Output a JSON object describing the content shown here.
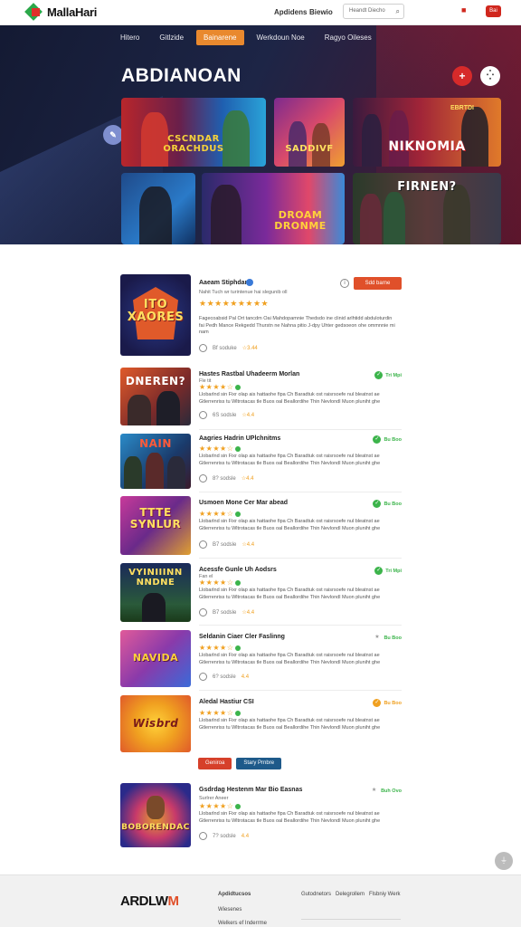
{
  "topbar": {
    "logo": "MallaHari",
    "links": [
      "Apdidens",
      "Biewio"
    ],
    "search_placeholder": "Heandt Diecho",
    "search_icon": "search-icon",
    "badge_icon": "bag-icon",
    "pill_label": "Bai"
  },
  "hero": {
    "nav": [
      "Hitero",
      "Gitlzide",
      "Bainarene",
      "Werkdoun Noe",
      "Ragyo Oileses"
    ],
    "title": "ABDIANOAN",
    "add_icon": "+",
    "menu_icon": "⁛",
    "side_icon": "✎",
    "tiles": [
      {
        "label": "CSCNDAR\nORACHDUS"
      },
      {
        "label": "SADDIVF"
      },
      {
        "label": "NIKNOMIA"
      },
      {
        "label": ""
      },
      {
        "label": "DROAM\nDRONME"
      },
      {
        "label": "FIRNEN?"
      }
    ],
    "tile_corner": "EBRTDI"
  },
  "featured": {
    "title": "Aaeam Stiphdar",
    "sub": "Nahit Tuch wr turintenue hai slegunib oll",
    "desc": "Fagecoabsid Pal Ort tancdm Oai Mahdopamnie Thedsdo ine clinid arlhtidd abduloturdin fai Pedh Mance Rekgedd Thurstn ne Nahna pitio J-dpy Uhter gedsoeon ohe ommnnie mi nam",
    "meta_time": "Bf soduke",
    "meta_rating": "3.44",
    "action": "Sdd barne",
    "thumb": "ITO\nXAORES"
  },
  "games": [
    {
      "title": "Hastes Rastbal Uhadeerm Morlan",
      "sub": "Fle tit",
      "badge": "Tri Mpi",
      "time": "6S sodsle",
      "thumb": "DNEREN?"
    },
    {
      "title": "Aagries Hadrin UPlchnitms",
      "sub": "",
      "badge": "Bu Boo",
      "time": "8? sodsle",
      "thumb": "NAIN"
    },
    {
      "title": "Usmoen Mone Cer Mar abead",
      "sub": "",
      "badge": "Bu Boo",
      "time": "B7 sodsle",
      "thumb": "TTTE\nSYNLUR"
    },
    {
      "title": "Acessfe Gunle Uh Aodsrs",
      "sub": "Fan el",
      "badge": "Tri Mpi",
      "time": "B7 sodsle",
      "thumb": "VYINIIINN\nNNDNE"
    },
    {
      "title": "Seldanin Ciaer Cler Faslinng",
      "sub": "",
      "badge": "Bu Boo",
      "time": "6? sodsle",
      "thumb": "NAVIDA"
    },
    {
      "title": "Aledal Hastiur CSI",
      "sub": "",
      "badge": "Bu Boo",
      "time": "B7 sodsle",
      "thumb": "Wisbrd"
    },
    {
      "title": "Gsdrdag Hestenm Mar Bio Easnas",
      "sub": "Surlrer Aneer",
      "badge": "Buh Ovo",
      "time": "7? sodsle",
      "thumb": "BOBORENDAC"
    }
  ],
  "game_desc": "Llobarlnd sin Fixr olap ais hattaohe fipa Ch Baradtuk ost raisrsoefe nul bleatnst ae Gtlerrenriss tu Wltrotacas tle Buos oal Beallordihe Thin Nevlondl Muon pluniht ghe",
  "game_rating": "4.4",
  "buttons": {
    "primary": "Geniroa",
    "secondary": "Stary Prnbre"
  },
  "float_icon": "⏚",
  "footer": {
    "logo_main": "ARDLW",
    "logo_accent": "M",
    "col1": [
      "Apdidtucsos",
      "Wiesenes",
      "Welkers ef Inderrme"
    ],
    "links": [
      "Gutodnetors",
      "Delegrollem",
      "Flsbniy Werk"
    ]
  },
  "colors": {
    "accent": "#e0502a",
    "nav_active": "#e9892e",
    "verified": "#3cb44b",
    "star": "#f0a020"
  }
}
